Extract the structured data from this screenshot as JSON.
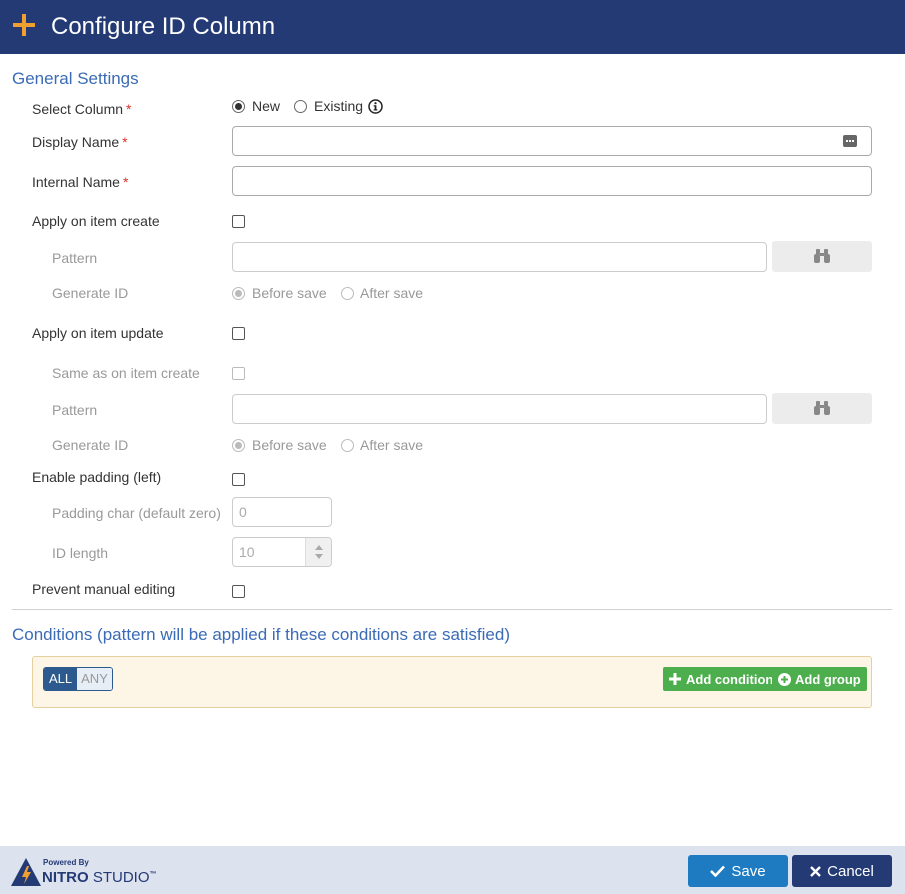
{
  "header": {
    "title": "Configure ID Column"
  },
  "general": {
    "section_title": "General Settings",
    "select_column": {
      "label": "Select Column",
      "option_new": "New",
      "option_existing": "Existing"
    },
    "display_name": {
      "label": "Display Name",
      "value": ""
    },
    "internal_name": {
      "label": "Internal Name",
      "value": ""
    },
    "apply_create": {
      "label": "Apply on item create",
      "pattern_label": "Pattern",
      "pattern_value": "",
      "generate_label": "Generate ID",
      "before_save": "Before save",
      "after_save": "After save"
    },
    "apply_update": {
      "label": "Apply on item update",
      "same_label": "Same as on item create",
      "pattern_label": "Pattern",
      "pattern_value": "",
      "generate_label": "Generate ID",
      "before_save": "Before save",
      "after_save": "After save"
    },
    "padding": {
      "label": "Enable padding (left)",
      "char_label": "Padding char (default zero)",
      "char_value": "0",
      "length_label": "ID length",
      "length_value": "10"
    },
    "prevent_label": "Prevent manual editing"
  },
  "conditions": {
    "section_title": "Conditions (pattern will be applied if these conditions are satisfied)",
    "toggle_all": "ALL",
    "toggle_any": "ANY",
    "add_condition": "Add condition",
    "add_group": "Add group"
  },
  "footer": {
    "powered_by": "Powered By",
    "brand_nitro": "NITRO",
    "brand_studio": "STUDIO",
    "brand_tm": "™",
    "save_label": "Save",
    "cancel_label": "Cancel"
  },
  "colors": {
    "header_bg": "#233a75",
    "accent": "#f0a030",
    "section_title": "#3b6bb5",
    "required": "#d9322b",
    "green": "#4cae4c",
    "save_btn": "#1f7bc1",
    "cancel_btn": "#233a75"
  }
}
